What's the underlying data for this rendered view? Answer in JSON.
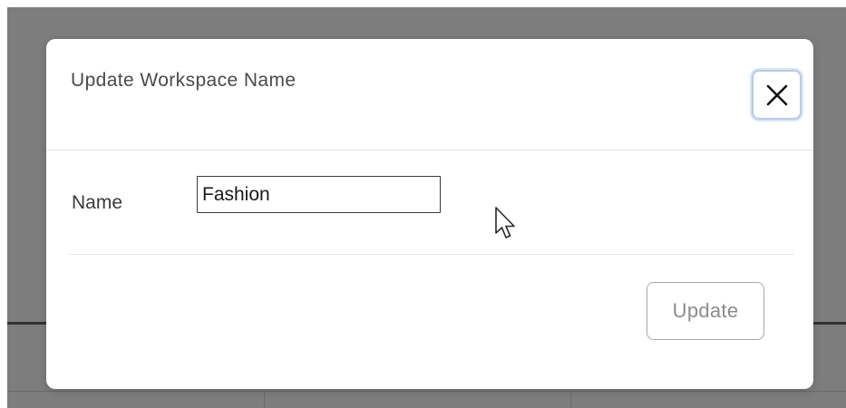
{
  "dialog": {
    "title": "Update Workspace Name",
    "close_icon": "close-icon",
    "fields": {
      "name": {
        "label": "Name",
        "value": "Fashion"
      }
    },
    "update_label": "Update"
  },
  "colors": {
    "backdrop": "#7d7d7d",
    "close_focus_ring": "#b6cbea",
    "button_text": "#8c8c8c"
  },
  "cursor_icon": "arrow-pointer-icon"
}
